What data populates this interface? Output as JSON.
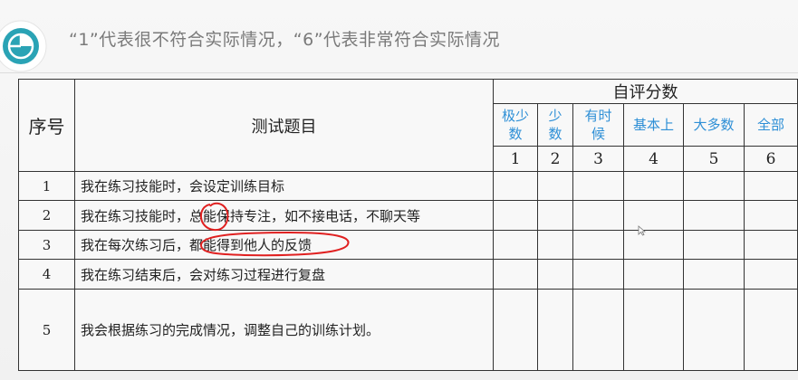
{
  "slide": {
    "heading": "“1”代表很不符合实际情况，“6”代表非常符合实际情况",
    "icon": "pie-chart-icon"
  },
  "table": {
    "col_no": "序号",
    "col_question": "测试题目",
    "col_score": "自评分数",
    "options": [
      {
        "label": "极少数",
        "value": "1"
      },
      {
        "label": "少数",
        "value": "2"
      },
      {
        "label": "有时候",
        "value": "3"
      },
      {
        "label": "基本上",
        "value": "4"
      },
      {
        "label": "大多数",
        "value": "5"
      },
      {
        "label": "全部",
        "value": "6"
      }
    ],
    "rows": [
      {
        "no": "1",
        "question": "我在练习技能时，会设定训练目标"
      },
      {
        "no": "2",
        "question": "我在练习技能时，总能保持专注，如不接电话，不聊天等"
      },
      {
        "no": "3",
        "question": "我在每次练习后，都能得到他人的反馈"
      },
      {
        "no": "4",
        "question": "我在练习结束后，会对练习过程进行复盘"
      },
      {
        "no": "5",
        "question": "我会根据练习的完成情况，调整自己的训练计划。"
      }
    ]
  },
  "colors": {
    "accent_teal": "#2aa3b5",
    "option_label_blue": "#2e8fd6",
    "annotation_red": "#e02020"
  }
}
